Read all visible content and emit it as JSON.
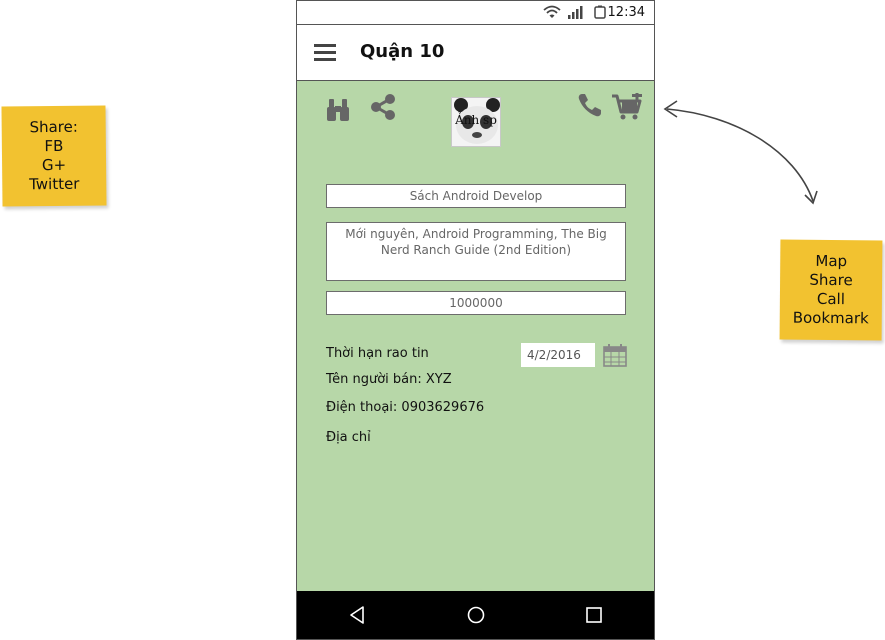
{
  "annotations": {
    "left_note": [
      "Share:",
      "FB",
      "G+",
      "Twitter"
    ],
    "right_note": [
      "Map",
      "Share",
      "Call",
      "Bookmark"
    ]
  },
  "status_bar": {
    "time": "12:34"
  },
  "app_bar": {
    "title": "Quận 10"
  },
  "product": {
    "image_label": "Ảnh sp",
    "title": "Sách Android Develop",
    "description": "Mới nguyên, Android Programming, The Big Nerd Ranch Guide (2nd Edition)",
    "price": "1000000"
  },
  "details": {
    "expiry_label": "Thời hạn rao tin",
    "expiry_date": "4/2/2016",
    "seller": "Tên người bán: XYZ",
    "phone": "Điện thoại: 0903629676",
    "address": "Địa chỉ"
  },
  "icons": {
    "top_left": [
      "binoculars-icon",
      "share-icon"
    ],
    "top_right": [
      "phone-icon",
      "add-to-cart-icon"
    ],
    "nav": [
      "back-icon",
      "home-icon",
      "recent-apps-icon"
    ]
  },
  "colors": {
    "content_background": "#b7d7a8",
    "note_background": "#f2c230",
    "icon_gray": "#666666"
  }
}
